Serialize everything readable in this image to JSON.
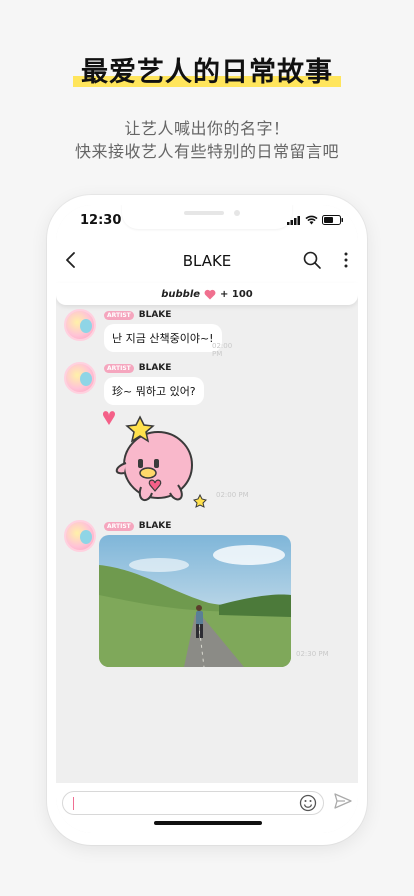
{
  "promo": {
    "headline": "最爱艺人的日常故事",
    "subtitle_line1": "让艺人喊出你的名字！",
    "subtitle_line2": "快来接收艺人有些特别的日常留言吧",
    "highlight_color": "#ffe55c"
  },
  "status_bar": {
    "time": "12:30"
  },
  "chat_header": {
    "title": "BLAKE"
  },
  "bubble_bar": {
    "brand": "bubble",
    "count": "+ 100",
    "heart_color": "#f0708f"
  },
  "messages": [
    {
      "tag": "ARTIST",
      "name": "BLAKE",
      "text": "난 지금 산책중이야~!",
      "time": "02:00 PM"
    },
    {
      "tag": "ARTIST",
      "name": "BLAKE",
      "text": "珍~ 뭐하고 있어?",
      "time": ""
    },
    {
      "sticker_time": "02:00 PM"
    },
    {
      "tag": "ARTIST",
      "name": "BLAKE",
      "photo_time": "02:30 PM"
    }
  ],
  "input": {
    "placeholder": ""
  }
}
